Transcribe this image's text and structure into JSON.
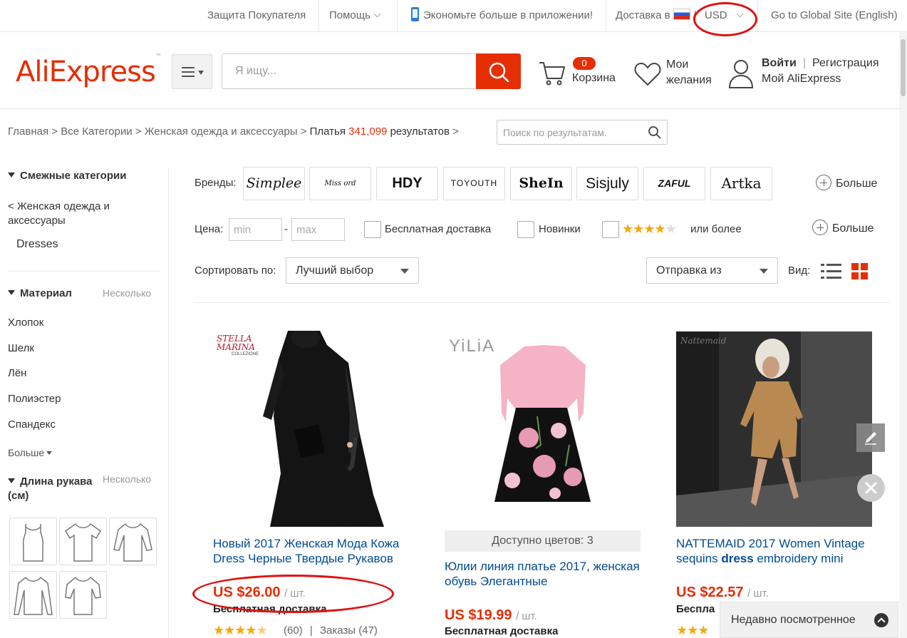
{
  "topbar": {
    "buyer_protection": "Защита Покупателя",
    "help": "Помощь",
    "app_promo": "Экономьте больше в приложении!",
    "ship_to": "Доставка в",
    "slash": "/",
    "currency": "USD",
    "global_site": "Go to Global Site (English)"
  },
  "header": {
    "logo": "AliExpress",
    "logo_tm": "™",
    "search_placeholder": "Я ищу...",
    "cart_count": "0",
    "cart_label": "Корзина",
    "wishlist_line1": "Мои",
    "wishlist_line2": "желания",
    "login": "Войти",
    "pipe": "|",
    "register": "Регистрация",
    "my_aliexpress": "Мой AliExpress"
  },
  "breadcrumb": {
    "home": "Главная",
    "all_categories": "Все Категории",
    "womens": "Женская одежда и аксессуары",
    "current": "Платья",
    "count": "341,099",
    "results": "результатов",
    "sep": ">",
    "search_placeholder": "Поиск по результатам."
  },
  "sidebar": {
    "related_title": "Смежные категории",
    "parent_link": "< Женская одежда и аксессуары",
    "current_cat": "Dresses",
    "material_title": "Материал",
    "multi": "Несколько",
    "materials": [
      "Хлопок",
      "Шелк",
      "Лён",
      "Полиэстер",
      "Спандекс"
    ],
    "more": "Больше",
    "sleeve_title": "Длина рукава (см)",
    "sleeve_multi": "Несколько"
  },
  "filters": {
    "brands_label": "Бренды:",
    "brands": [
      "Simplee",
      "Miss ord",
      "HDY",
      "TOYOUTH",
      "SheIn",
      "Sisjuly",
      "ZAFUL",
      "Artka"
    ],
    "brands_more": "Больше",
    "price_label": "Цена:",
    "min_placeholder": "min",
    "dash": "-",
    "max_placeholder": "max",
    "free_shipping": "Бесплатная доставка",
    "new": "Новинки",
    "rating_suffix": "или более",
    "rating_stars": 4,
    "filters_more": "Больше",
    "sort_label": "Сортировать по:",
    "sort_value": "Лучший выбор",
    "ship_from": "Отправка из",
    "view_label": "Вид:"
  },
  "products": [
    {
      "brand_mark": "STELLA MARINA",
      "brand_sub": "COLLEZIONE",
      "title": "Новый 2017 Женская Мода Кожа Dress Черные Твердые Рукавов",
      "price": "US $26.00",
      "unit": "/ шт.",
      "shipping": "Бесплатная доставка",
      "rating": 4.5,
      "reviews": "(60)",
      "orders": "Заказы (47)",
      "meta_sep": "|"
    },
    {
      "brand_mark": "YiLiA",
      "colors": "Доступно цветов: 3",
      "title": "Юлии линия платье 2017, женская обувь Элегантные",
      "price": "US $19.99",
      "unit": "/ шт.",
      "shipping": "Бесплатная доставка"
    },
    {
      "brand_mark": "Nattemaid",
      "title_a": "NATTEMAID 2017 Women Vintage sequins ",
      "title_b": "dress",
      "title_c": " embroidery mini",
      "price": "US $22.57",
      "unit": "/ шт.",
      "shipping": "Беспла"
    }
  ],
  "recently_viewed": "Недавно посмотренное",
  "colors": {
    "accent": "#e62e04",
    "link": "#004b91",
    "star": "#f7a70a",
    "annotation": "#e01010"
  }
}
